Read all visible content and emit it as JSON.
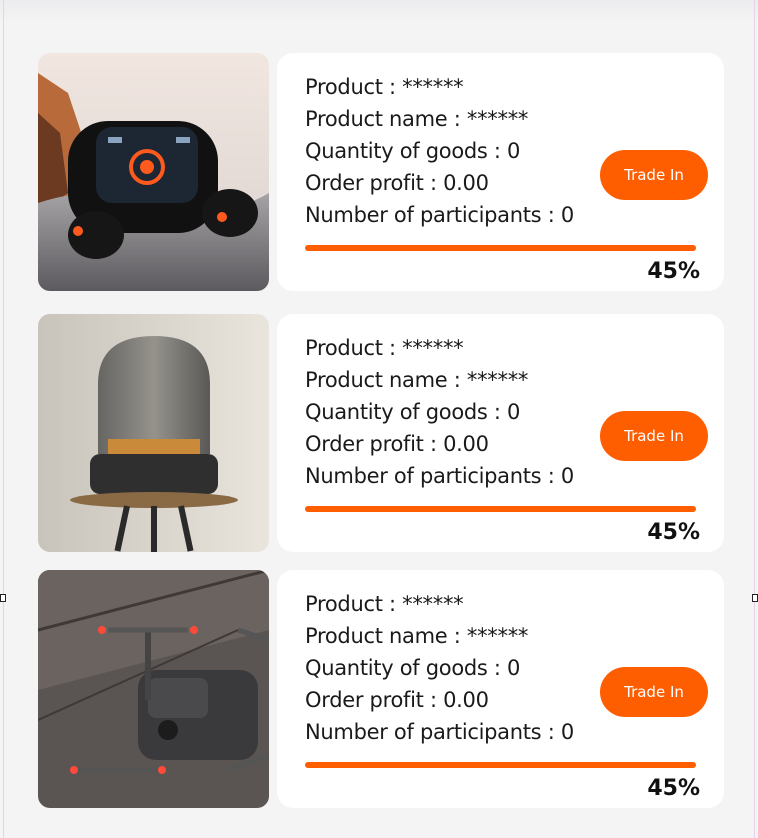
{
  "colors": {
    "accent": "#ff5e00",
    "card_background": "#ffffff",
    "page_background": "#f4f4f5"
  },
  "items": [
    {
      "image": "earbuds-with-display-case",
      "product_line": "Product :  ******",
      "name_line": "Product name : ******",
      "quantity_line": "Quantity of goods : 0",
      "profit_line": "Order profit : 0.00",
      "participants_line": "Number of participants : 0",
      "button_label": "Trade In",
      "progress": 100,
      "percent_label": "45%"
    },
    {
      "image": "glass-dome-speaker",
      "product_line": "Product :  ******",
      "name_line": "Product name : ******",
      "quantity_line": "Quantity of goods : 0",
      "profit_line": "Order profit : 0.00",
      "participants_line": "Number of participants : 0",
      "button_label": "Trade In",
      "progress": 100,
      "percent_label": "45%"
    },
    {
      "image": "fpv-drone",
      "product_line": "Product :  ******",
      "name_line": "Product name : ******",
      "quantity_line": "Quantity of goods : 0",
      "profit_line": "Order profit : 0.00",
      "participants_line": "Number of participants : 0",
      "button_label": "Trade In",
      "progress": 100,
      "percent_label": "45%"
    }
  ]
}
